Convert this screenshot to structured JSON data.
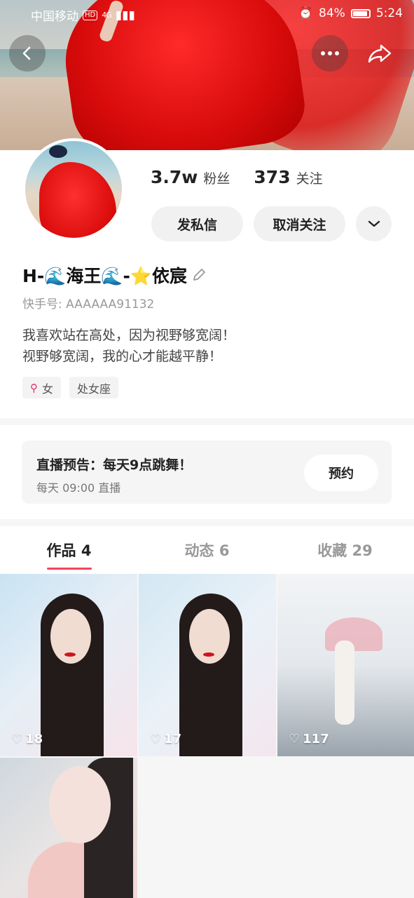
{
  "status_bar": {
    "carrier": "中国移动",
    "hd": "HD",
    "network": "4G",
    "battery": "84%",
    "time": "5:24"
  },
  "profile": {
    "followers_count": "3.7w",
    "followers_label": "粉丝",
    "following_count": "373",
    "following_label": "关注",
    "message_button": "发私信",
    "unfollow_button": "取消关注",
    "username": "H-🌊海王🌊-⭐依宸",
    "kuaishou_id": "快手号: AAAAAA91132",
    "bio_line1": "我喜欢站在高处，因为视野够宽阔！",
    "bio_line2": "视野够宽阔，我的心才能越平静！",
    "tags": [
      "女",
      "处女座"
    ]
  },
  "live_notice": {
    "title": "直播预告：每天9点跳舞！",
    "time": "每天 09:00 直播",
    "reserve_button": "预约"
  },
  "tabs": [
    {
      "label": "作品 4",
      "active": true
    },
    {
      "label": "动态 6",
      "active": false
    },
    {
      "label": "收藏 29",
      "active": false
    }
  ],
  "works": [
    {
      "likes": "18"
    },
    {
      "likes": "17"
    },
    {
      "likes": "117"
    },
    {
      "likes": ""
    }
  ],
  "colors": {
    "accent": "#f5455c",
    "button_bg": "#f1f1f1"
  }
}
